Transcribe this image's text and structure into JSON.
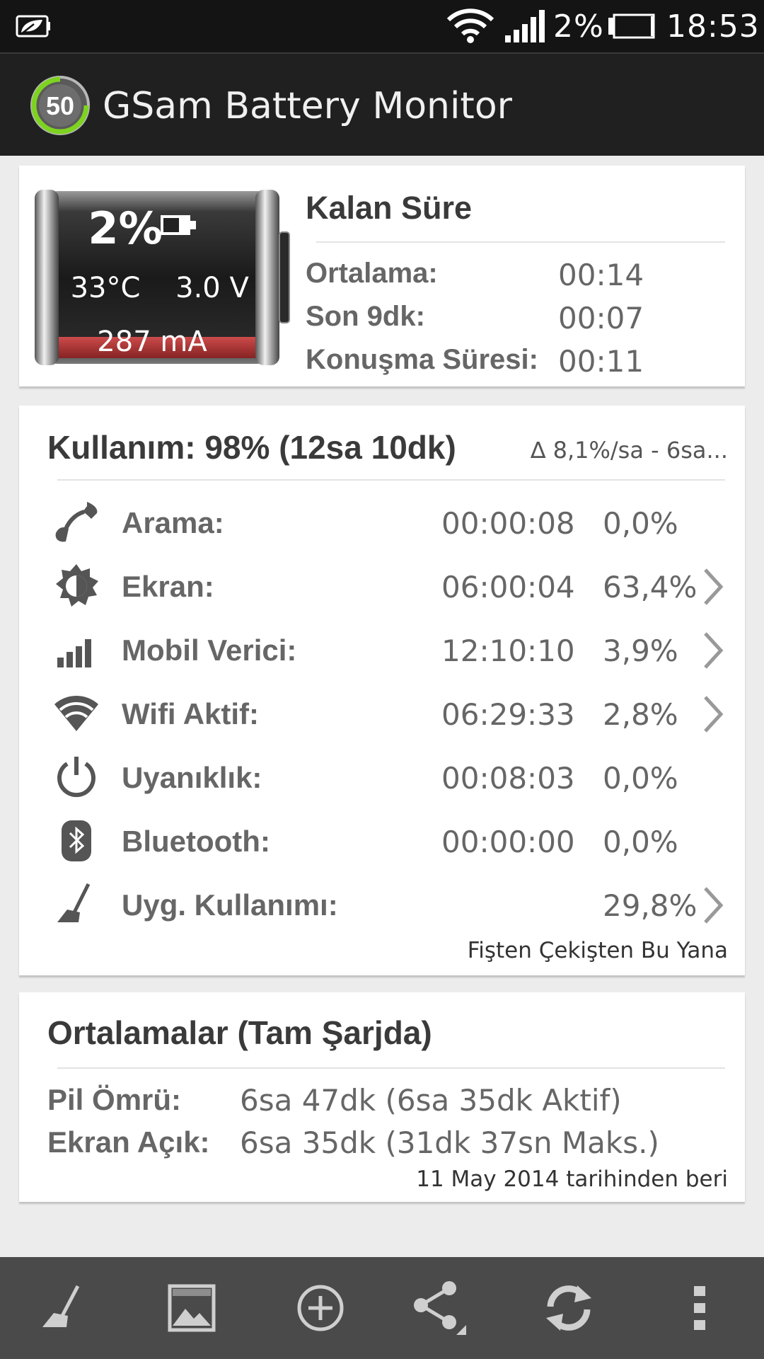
{
  "status_bar": {
    "battery_saver_icon": "leaf-battery-icon",
    "wifi_icon": "wifi-icon",
    "signal_icon": "signal-icon",
    "battery_percent": "2%",
    "time": "18:53"
  },
  "app_bar": {
    "logo_number": "50",
    "title": "GSam Battery Monitor"
  },
  "battery_card": {
    "percent": "2%",
    "temperature": "33°C",
    "voltage": "3.0 V",
    "current": "287 mA",
    "level": 0.02
  },
  "remaining_time": {
    "title": "Kalan Süre",
    "rows": [
      {
        "label": "Ortalama:",
        "value": "00:14"
      },
      {
        "label": "Son 9dk:",
        "value": "00:07"
      },
      {
        "label": "Konuşma Süresi:",
        "value": "00:11"
      }
    ]
  },
  "usage": {
    "title": "Kullanım: 98% (12sa 10dk)",
    "delta": "∆ 8,1%/sa - 6sa...",
    "rows": [
      {
        "icon": "phone-icon",
        "label": "Arama:",
        "time": "00:00:08",
        "percent": "0,0%",
        "has_chevron": false
      },
      {
        "icon": "brightness-icon",
        "label": "Ekran:",
        "time": "06:00:04",
        "percent": "63,4%",
        "has_chevron": true
      },
      {
        "icon": "signal-bars-icon",
        "label": "Mobil Verici:",
        "time": "12:10:10",
        "percent": "3,9%",
        "has_chevron": true
      },
      {
        "icon": "wifi-icon",
        "label": "Wifi Aktif:",
        "time": "06:29:33",
        "percent": "2,8%",
        "has_chevron": true
      },
      {
        "icon": "power-icon",
        "label": "Uyanıklık:",
        "time": "00:08:03",
        "percent": "0,0%",
        "has_chevron": false
      },
      {
        "icon": "bluetooth-icon",
        "label": "Bluetooth:",
        "time": "00:00:00",
        "percent": "0,0%",
        "has_chevron": false
      },
      {
        "icon": "broom-icon",
        "label": "Uyg. Kullanımı:",
        "time": "",
        "percent": "29,8%",
        "has_chevron": true
      }
    ],
    "footer": "Fişten Çekişten Bu Yana"
  },
  "averages": {
    "title": "Ortalamalar (Tam Şarjda)",
    "rows": [
      {
        "label": "Pil Ömrü:",
        "value": "6sa 47dk (6sa 35dk Aktif)"
      },
      {
        "label": "Ekran Açık:",
        "value": "6sa 35dk (31dk 37sn Maks.)"
      }
    ],
    "since": "11 May 2014 tarihinden beri"
  },
  "bottom_bar": {
    "buttons": [
      "broom-icon",
      "image-icon",
      "add-icon",
      "share-icon",
      "refresh-icon",
      "overflow-menu-icon"
    ]
  },
  "colors": {
    "status_bar": "#141414",
    "app_bar": "#202020",
    "background": "#ececec",
    "card": "#ffffff",
    "bottom_bar": "#4a4a4a",
    "logo_ring": "#7ed321",
    "battery_level": "#c0392b"
  }
}
